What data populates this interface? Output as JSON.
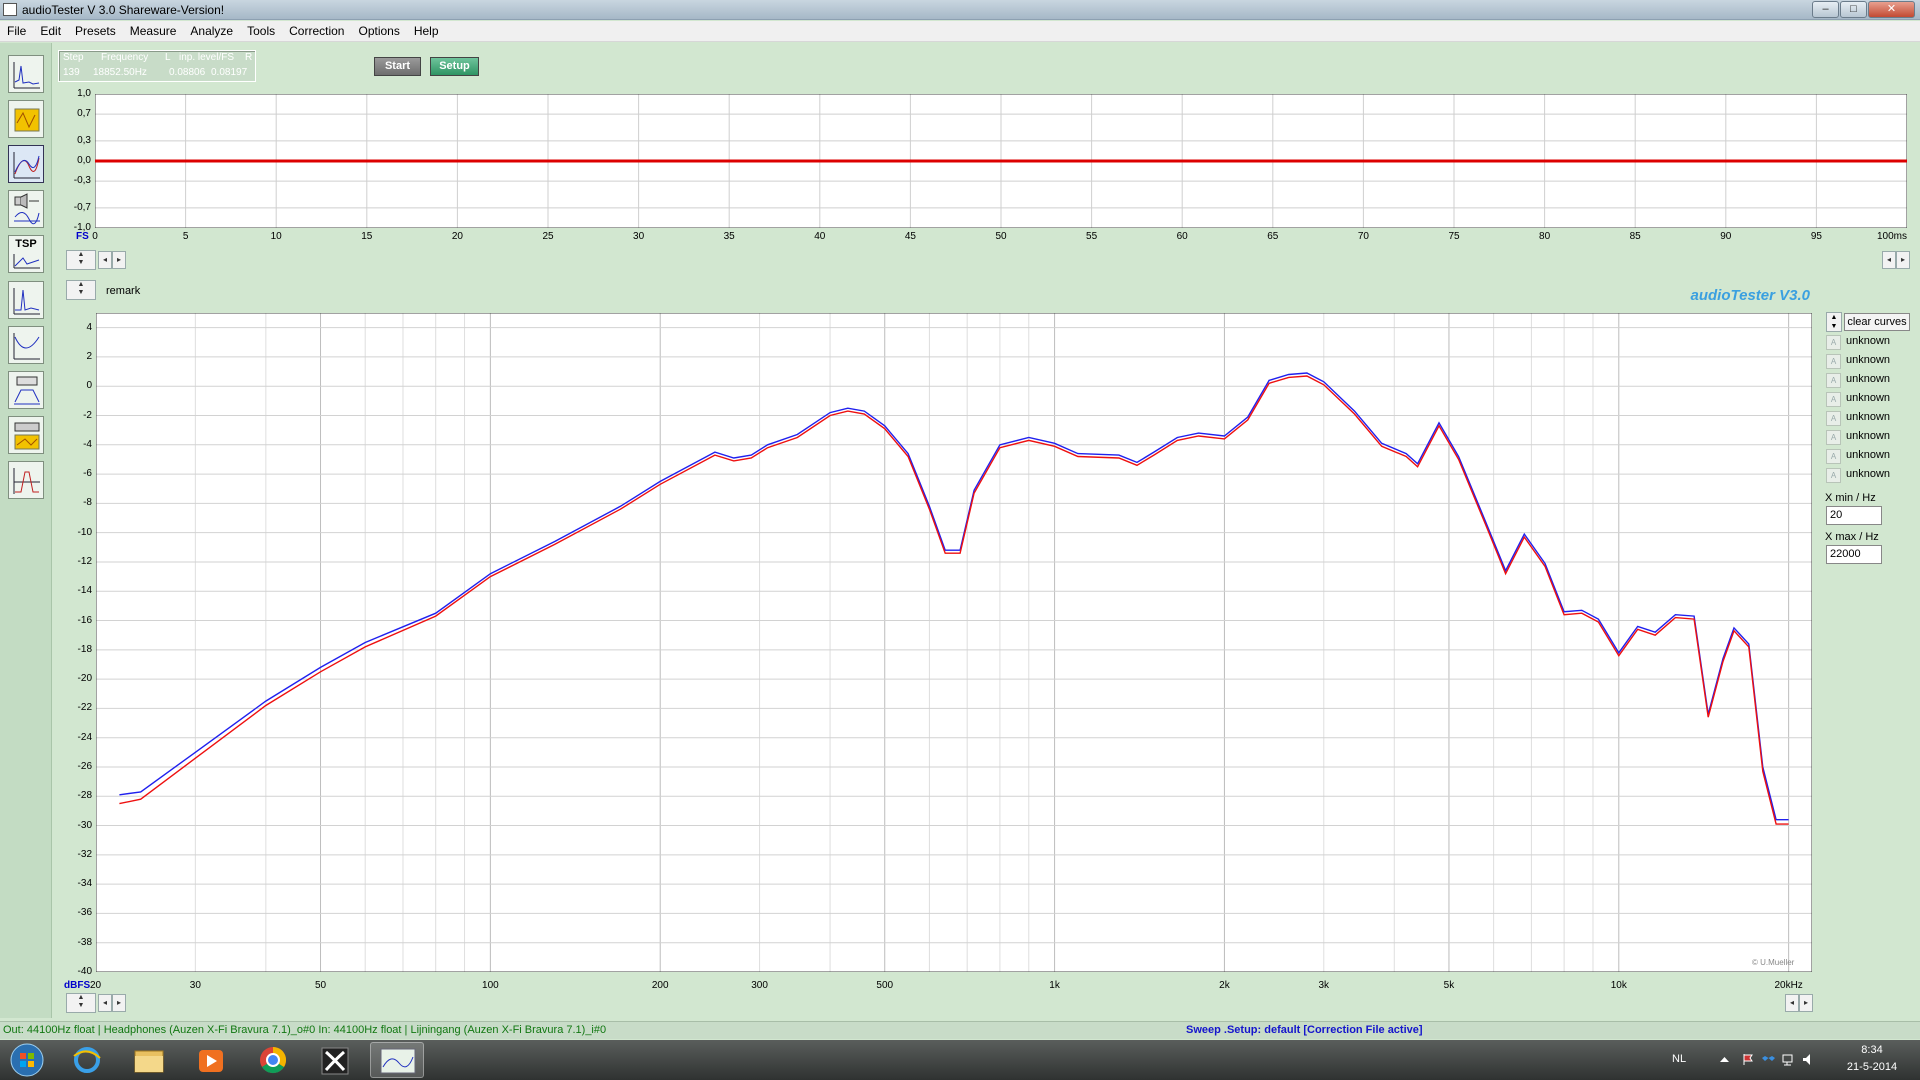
{
  "window": {
    "title": "audioTester  V 3.0 Shareware-Version!"
  },
  "menu": [
    "File",
    "Edit",
    "Presets",
    "Measure",
    "Analyze",
    "Tools",
    "Correction",
    "Options",
    "Help"
  ],
  "status": {
    "headers": [
      "Step",
      "Frequency",
      "L",
      "inp. level/FS",
      "R"
    ],
    "values": [
      "139",
      "18852.50Hz",
      "0.08806",
      "0.08197"
    ]
  },
  "buttons": {
    "start": "Start",
    "setup": "Setup",
    "clear_curves": "clear curves"
  },
  "labels": {
    "remark": "remark",
    "brand": "audioTester  V3.0",
    "copyright": "© U.Mueller"
  },
  "curves": [
    "unknown",
    "unknown",
    "unknown",
    "unknown",
    "unknown",
    "unknown",
    "unknown",
    "unknown"
  ],
  "fields": {
    "xmin_label": "X min / Hz",
    "xmin_value": "20",
    "xmax_label": "X max / Hz",
    "xmax_value": "22000"
  },
  "statusbar": {
    "left": "Out: 44100Hz float  | Headphones (Auzen X-Fi Bravura 7.1)_o#0   In: 44100Hz float  | Lijningang (Auzen X-Fi Bravura 7.1)_i#0",
    "right": "Sweep  .Setup:  default  [Correction File active]"
  },
  "taskbar": {
    "language": "NL",
    "time": "8:34",
    "date": "21-5-2014"
  },
  "chart_data": [
    {
      "type": "line",
      "title": "",
      "xlabel": "ms",
      "ylabel": "FS",
      "xlim": [
        0,
        100
      ],
      "ylim": [
        -1.0,
        1.0
      ],
      "x_ticks": [
        0,
        5,
        10,
        15,
        20,
        25,
        30,
        35,
        40,
        45,
        50,
        55,
        60,
        65,
        70,
        75,
        80,
        85,
        90,
        95,
        100
      ],
      "x_tick_labels": [
        "0",
        "5",
        "10",
        "15",
        "20",
        "25",
        "30",
        "35",
        "40",
        "45",
        "50",
        "55",
        "60",
        "65",
        "70",
        "75",
        "80",
        "85",
        "90",
        "95",
        "100ms"
      ],
      "y_ticks": [
        1.0,
        0.7,
        0.3,
        0.0,
        -0.3,
        -0.7,
        -1.0
      ],
      "y_tick_labels": [
        "1,0",
        "0,7",
        "0,3",
        "0,0",
        "-0,3",
        "-0,7",
        "-1,0"
      ],
      "series": [
        {
          "color": "#dd0000",
          "x": [
            0,
            100
          ],
          "y": [
            0.0,
            0.0
          ]
        }
      ],
      "grid": true
    },
    {
      "type": "line",
      "title": "",
      "xlabel": "Hz",
      "ylabel": "dBFS",
      "x_scale": "log",
      "xlim": [
        20,
        22000
      ],
      "ylim": [
        -40,
        5
      ],
      "x_tick_labels": [
        {
          "v": 30,
          "t": "30"
        },
        {
          "v": 50,
          "t": "50"
        },
        {
          "v": 100,
          "t": "100"
        },
        {
          "v": 200,
          "t": "200"
        },
        {
          "v": 300,
          "t": "300"
        },
        {
          "v": 500,
          "t": "500"
        },
        {
          "v": 1000,
          "t": "1k"
        },
        {
          "v": 2000,
          "t": "2k"
        },
        {
          "v": 3000,
          "t": "3k"
        },
        {
          "v": 5000,
          "t": "5k"
        },
        {
          "v": 10000,
          "t": "10k"
        },
        {
          "v": 20000,
          "t": "20kHz"
        }
      ],
      "y_ticks": [
        4,
        2,
        0,
        -2,
        -4,
        -6,
        -8,
        -10,
        -12,
        -14,
        -16,
        -18,
        -20,
        -22,
        -24,
        -26,
        -28,
        -30,
        -32,
        -34,
        -36,
        -38,
        -40
      ],
      "grid": true,
      "series": [
        {
          "color": "#2020ee",
          "x": [
            22,
            24,
            30,
            40,
            50,
            60,
            80,
            100,
            130,
            170,
            200,
            250,
            270,
            290,
            310,
            350,
            400,
            430,
            460,
            500,
            550,
            600,
            640,
            680,
            720,
            800,
            900,
            1000,
            1100,
            1300,
            1400,
            1500,
            1650,
            1800,
            2000,
            2200,
            2400,
            2600,
            2800,
            3000,
            3400,
            3800,
            4200,
            4400,
            4800,
            5200,
            5800,
            6300,
            6800,
            7400,
            8000,
            8600,
            9200,
            10000,
            10800,
            11600,
            12600,
            13600,
            14400,
            15300,
            16000,
            17000,
            18000,
            19000,
            20000
          ],
          "y": [
            -27.9,
            -27.7,
            -25.0,
            -21.5,
            -19.2,
            -17.5,
            -15.5,
            -12.8,
            -10.6,
            -8.2,
            -6.5,
            -4.5,
            -4.9,
            -4.7,
            -4.0,
            -3.3,
            -1.8,
            -1.5,
            -1.7,
            -2.7,
            -4.6,
            -8.2,
            -11.2,
            -11.2,
            -7.1,
            -4.0,
            -3.5,
            -3.9,
            -4.6,
            -4.7,
            -5.2,
            -4.5,
            -3.5,
            -3.2,
            -3.4,
            -2.1,
            0.4,
            0.8,
            0.9,
            0.3,
            -1.7,
            -3.9,
            -4.6,
            -5.3,
            -2.5,
            -4.8,
            -9.2,
            -12.6,
            -10.1,
            -12.1,
            -15.4,
            -15.3,
            -15.9,
            -18.2,
            -16.4,
            -16.8,
            -15.6,
            -15.7,
            -22.4,
            -18.6,
            -16.5,
            -17.6,
            -26.0,
            -29.6,
            -29.6
          ]
        },
        {
          "color": "#ee1010",
          "x": [
            22,
            24,
            30,
            40,
            50,
            60,
            80,
            100,
            130,
            170,
            200,
            250,
            270,
            290,
            310,
            350,
            400,
            430,
            460,
            500,
            550,
            600,
            640,
            680,
            720,
            800,
            900,
            1000,
            1100,
            1300,
            1400,
            1500,
            1650,
            1800,
            2000,
            2200,
            2400,
            2600,
            2800,
            3000,
            3400,
            3800,
            4200,
            4400,
            4800,
            5200,
            5800,
            6300,
            6800,
            7400,
            8000,
            8600,
            9200,
            10000,
            10800,
            11600,
            12600,
            13600,
            14400,
            15300,
            16000,
            17000,
            18000,
            19000,
            20000
          ],
          "y": [
            -28.5,
            -28.2,
            -25.4,
            -21.8,
            -19.5,
            -17.8,
            -15.7,
            -13.0,
            -10.8,
            -8.4,
            -6.7,
            -4.7,
            -5.1,
            -4.9,
            -4.2,
            -3.5,
            -2.0,
            -1.7,
            -1.9,
            -2.9,
            -4.8,
            -8.4,
            -11.4,
            -11.4,
            -7.3,
            -4.2,
            -3.7,
            -4.1,
            -4.8,
            -4.9,
            -5.4,
            -4.7,
            -3.7,
            -3.4,
            -3.6,
            -2.3,
            0.2,
            0.6,
            0.7,
            0.1,
            -1.9,
            -4.1,
            -4.8,
            -5.5,
            -2.7,
            -5.0,
            -9.4,
            -12.8,
            -10.3,
            -12.3,
            -15.6,
            -15.5,
            -16.1,
            -18.4,
            -16.6,
            -17.0,
            -15.8,
            -15.9,
            -22.6,
            -18.8,
            -16.7,
            -17.8,
            -26.3,
            -29.9,
            -29.9
          ]
        }
      ]
    }
  ]
}
